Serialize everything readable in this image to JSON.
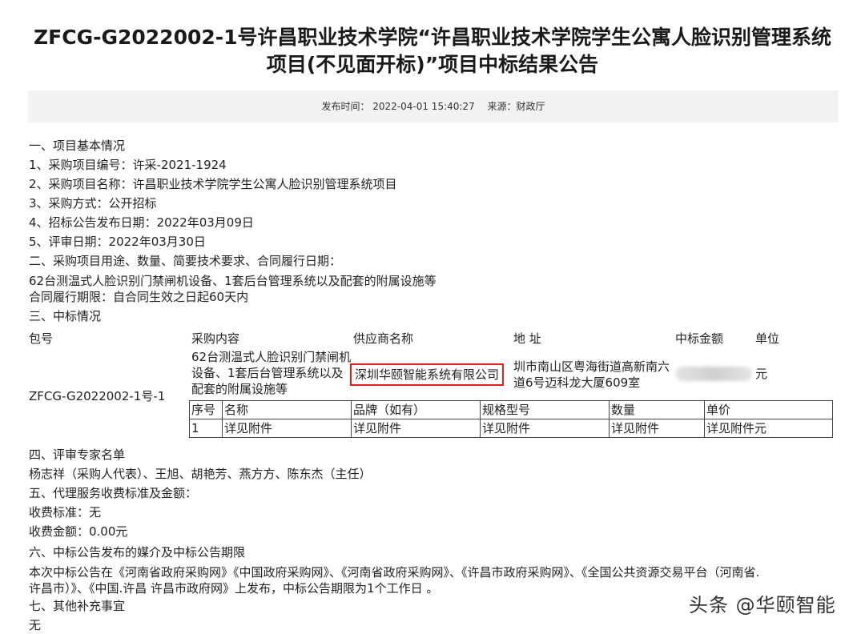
{
  "title": "ZFCG-G2022002-1号许昌职业技术学院“许昌职业技术学院学生公寓人脸识别管理系统项目(不见面开标)”项目中标结果公告",
  "meta": {
    "publish_time": "发布时间：  2022-04-01 15:40:27",
    "source": "来源：财政厅"
  },
  "sections": {
    "basic_title": "一、项目基本情况",
    "project_no": "1、采购项目编号：许采-2021-1924",
    "project_name": "2、采购项目名称：许昌职业技术学院学生公寓人脸识别管理系统项目",
    "method": "3、采购方式：公开招标",
    "notice_date": "4、招标公告发布日期：2022年03月09日",
    "review_date": "5、评审日期：2022年03月30日",
    "usage_title": "二、采购项目用途、数量、简要技术要求、合同履行日期：",
    "usage_desc": "62台测温式人脸识别门禁闸机设备、1套后台管理系统以及配套的附属设施等",
    "contract_period": "合同履行期限：自合同生效之日起60天内",
    "award_title": "三、中标情况",
    "experts_title": "四、评审专家名单",
    "experts": "杨志祥（采购人代表）、王旭、胡艳芳、燕方方、陈东杰（主任）",
    "fee_title": "五、代理服务收费标准及金额：",
    "fee_standard": "收费标准：无",
    "fee_amount": "收费金额：0.00元",
    "media_title": "六、中标公告发布的媒介及中标公告期限",
    "media_line1": "本次中标公告在《河南省政府采购网》《中国政府采购网》、《河南省政府采购网》、《许昌市政府采购网》、《全国公共资源交易平台（河南省.",
    "media_line2": "许昌市）》、《中国.许昌 许昌市政府网》上发布，中标公告期限为1个工作日 。",
    "other_title": "七、其他补充事宜",
    "other_value": "无"
  },
  "award": {
    "headers": {
      "package": "包号",
      "content": "采购内容",
      "supplier": "供应商名称",
      "address": "地 址",
      "amount": "中标金额",
      "unit": "单位"
    },
    "package_no": "ZFCG-G2022002-1号-1",
    "content": "62台测温式人脸识别门禁闸机设备、1套后台管理系统以及配套的附属设施等",
    "supplier": "深圳华颐智能系统有限公司",
    "address": "圳市南山区粤海街道高新南六道6号迈科龙大厦609室",
    "unit": "元"
  },
  "items_table": {
    "headers": [
      "序号",
      "名称",
      "品牌（如有）",
      "规格型号",
      "数量",
      "单价"
    ],
    "row": [
      "1",
      "详见附件",
      "详见附件",
      "详见附件",
      "详见附件",
      "详见附件元"
    ]
  },
  "watermark": "头条 @华颐智能"
}
